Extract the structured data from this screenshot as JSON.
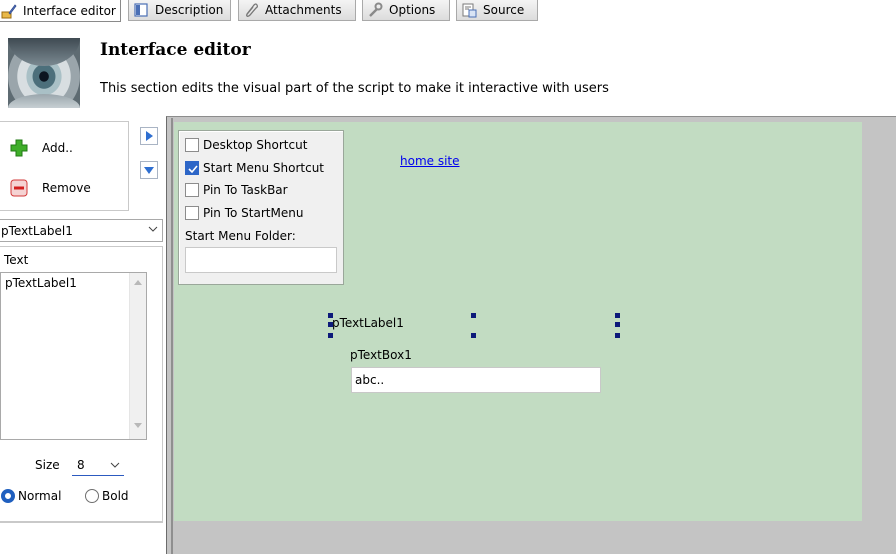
{
  "tabs": [
    {
      "label": "Interface editor",
      "icon": "interface-editor-icon",
      "active": true
    },
    {
      "label": "Description",
      "icon": "description-icon",
      "active": false
    },
    {
      "label": "Attachments",
      "icon": "paperclip-icon",
      "active": false
    },
    {
      "label": "Options",
      "icon": "wrench-icon",
      "active": false
    },
    {
      "label": "Source",
      "icon": "source-icon",
      "active": false
    }
  ],
  "header": {
    "title": "Interface editor",
    "description": "This section edits the visual part of the script to make it interactive with users"
  },
  "left_panel": {
    "add_label": "Add..",
    "remove_label": "Remove",
    "selected_control": "pTextLabel1",
    "property_label": "Text",
    "text_value": "pTextLabel1",
    "size_label": "Size",
    "size_value": "8",
    "font_style": {
      "normal_label": "Normal",
      "bold_label": "Bold",
      "selected": "Normal"
    }
  },
  "canvas": {
    "checkboxes": [
      {
        "label": "Desktop Shortcut",
        "checked": false
      },
      {
        "label": "Start Menu Shortcut",
        "checked": true
      },
      {
        "label": "Pin To TaskBar",
        "checked": false
      },
      {
        "label": "Pin To StartMenu",
        "checked": false
      }
    ],
    "folder_label": "Start Menu Folder:",
    "folder_value": "",
    "home_link": "home site",
    "text_label": "pTextLabel1",
    "textbox_label": "pTextBox1",
    "textbox_value": "abc.."
  },
  "colors": {
    "canvas_bg": "#c2dcc2",
    "frame_bg": "#c4c4c4",
    "accent_blue": "#2d66c7",
    "handle": "#0d1a7a",
    "link": "#0000ee"
  }
}
